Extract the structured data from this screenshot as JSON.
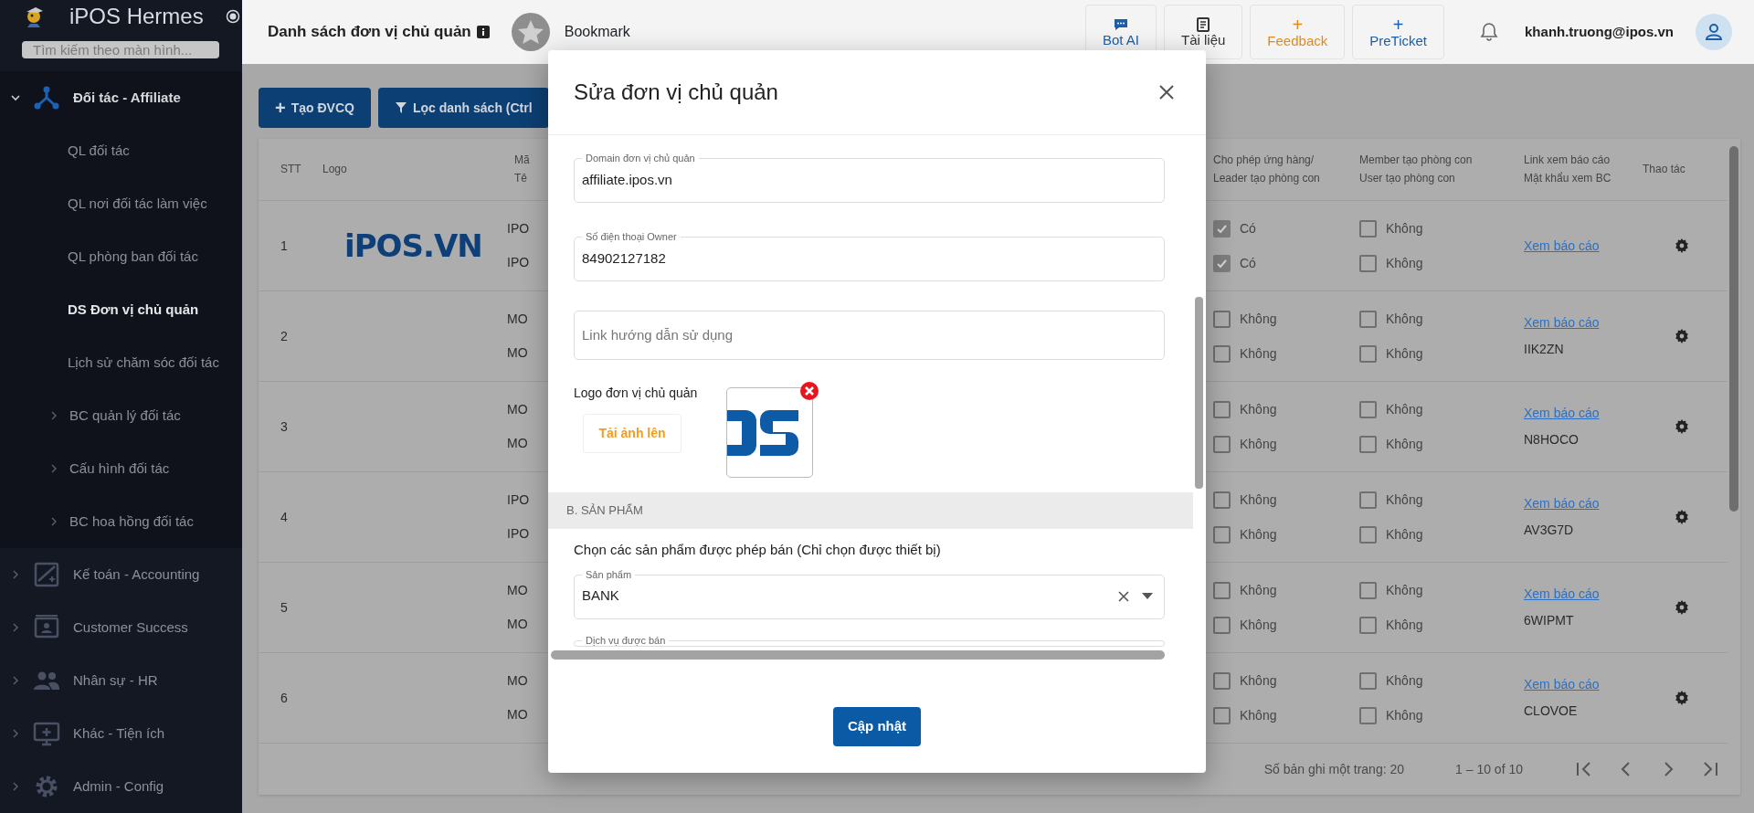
{
  "sidebar": {
    "app_name": "iPOS Hermes",
    "search": {
      "placeholder": "Tìm kiếm theo màn hình..."
    },
    "items": [
      {
        "label": "Đối tác - Affiliate",
        "expanded": true,
        "children": [
          {
            "label": "QL đối tác",
            "kind": "link",
            "selected": false
          },
          {
            "label": "QL nơi đối tác làm việc",
            "kind": "link",
            "selected": false
          },
          {
            "label": "QL phòng ban đối tác",
            "kind": "link",
            "selected": false
          },
          {
            "label": "DS Đơn vị chủ quản",
            "kind": "link",
            "selected": true
          },
          {
            "label": "Lịch sử chăm sóc đối tác",
            "kind": "link",
            "selected": false
          },
          {
            "label": "BC quản lý đối tác",
            "kind": "group",
            "selected": false
          },
          {
            "label": "Cấu hình đối tác",
            "kind": "group",
            "selected": false
          },
          {
            "label": "BC hoa hồng đối tác",
            "kind": "group",
            "selected": false
          }
        ]
      },
      {
        "label": "Kế toán - Accounting",
        "expanded": false
      },
      {
        "label": "Customer Success",
        "expanded": false
      },
      {
        "label": "Nhân sự - HR",
        "expanded": false
      },
      {
        "label": "Khác - Tiện ích",
        "expanded": false
      },
      {
        "label": "Admin - Config",
        "expanded": false
      }
    ]
  },
  "header": {
    "title": "Danh sách đơn vị chủ quản",
    "bookmark": "Bookmark",
    "actions": [
      {
        "label": "Bot AI",
        "kind": "chat",
        "color": "#1a5fa8"
      },
      {
        "label": "Tài liệu",
        "kind": "book",
        "color": "#333333"
      },
      {
        "label": "Feedback",
        "kind": "plus",
        "symbol": "+",
        "color": "#e08a1e"
      },
      {
        "label": "PreTicket",
        "kind": "plus",
        "symbol": "+",
        "color": "#1a5fa8"
      }
    ],
    "user": "khanh.truong@ipos.vn"
  },
  "toolbar": {
    "buttons": [
      {
        "label": "Tạo ĐVCQ",
        "symbol": "+",
        "kind": "add"
      },
      {
        "label": "Lọc danh sách (Ctrl",
        "kind": "filter"
      }
    ]
  },
  "table": {
    "columns": [
      {
        "lines": [
          "STT"
        ]
      },
      {
        "lines": [
          "Logo"
        ]
      },
      {
        "lines": [
          "Mã",
          "Tê"
        ]
      },
      {
        "lines": [
          "Cho phép ứng hàng/",
          "Leader tạo phòng con"
        ]
      },
      {
        "lines": [
          "Member tạo phòng con",
          "User tạo phòng con"
        ]
      },
      {
        "lines": [
          "Link xem báo cáo",
          "Mật khẩu xem BC"
        ]
      },
      {
        "lines": [
          "Thao tác"
        ]
      }
    ],
    "rows": [
      {
        "stt": "1",
        "logo_text": "iPOS.VN",
        "code": [
          "IPO",
          "IPO"
        ],
        "allow": [
          {
            "checked": true,
            "label": "Có"
          },
          {
            "checked": true,
            "label": "Có"
          }
        ],
        "member": [
          {
            "checked": false,
            "label": "Không"
          },
          {
            "checked": false,
            "label": "Không"
          }
        ],
        "link": "Xem báo cáo"
      },
      {
        "stt": "2",
        "code": [
          "MO",
          "MO"
        ],
        "allow": [
          {
            "checked": false,
            "label": "Không"
          },
          {
            "checked": false,
            "label": "Không"
          }
        ],
        "member": [
          {
            "checked": false,
            "label": "Không"
          },
          {
            "checked": false,
            "label": "Không"
          }
        ],
        "link": "Xem báo cáo",
        "password": "IIK2ZN"
      },
      {
        "stt": "3",
        "code": [
          "MO",
          "MO"
        ],
        "allow": [
          {
            "checked": false,
            "label": "Không"
          },
          {
            "checked": false,
            "label": "Không"
          }
        ],
        "member": [
          {
            "checked": false,
            "label": "Không"
          },
          {
            "checked": false,
            "label": "Không"
          }
        ],
        "link": "Xem báo cáo",
        "password": "N8HOCO"
      },
      {
        "stt": "4",
        "code": [
          "IPO",
          "IPO"
        ],
        "allow": [
          {
            "checked": false,
            "label": "Không"
          },
          {
            "checked": false,
            "label": "Không"
          }
        ],
        "member": [
          {
            "checked": false,
            "label": "Không"
          },
          {
            "checked": false,
            "label": "Không"
          }
        ],
        "link": "Xem báo cáo",
        "password": "AV3G7D"
      },
      {
        "stt": "5",
        "code": [
          "MO",
          "MO"
        ],
        "allow": [
          {
            "checked": false,
            "label": "Không"
          },
          {
            "checked": false,
            "label": "Không"
          }
        ],
        "member": [
          {
            "checked": false,
            "label": "Không"
          },
          {
            "checked": false,
            "label": "Không"
          }
        ],
        "link": "Xem báo cáo",
        "password": "6WIPMT"
      },
      {
        "stt": "6",
        "code": [
          "MO",
          "MO"
        ],
        "allow": [
          {
            "checked": false,
            "label": "Không"
          },
          {
            "checked": false,
            "label": "Không"
          }
        ],
        "member": [
          {
            "checked": false,
            "label": "Không"
          },
          {
            "checked": false,
            "label": "Không"
          }
        ],
        "link": "Xem báo cáo",
        "password": "CLOVOE"
      }
    ],
    "pagination": {
      "page_size": "Số bản ghi một trang: 20",
      "range": "1 – 10 of 10"
    }
  },
  "modal": {
    "title": "Sửa đơn vị chủ quản",
    "fields": [
      {
        "label": "Domain đơn vị chủ quản",
        "value": "affiliate.ipos.vn"
      },
      {
        "label": "Số điện thoại Owner",
        "value": "84902127182"
      },
      {
        "placeholder": "Link hướng dẫn sử dụng"
      }
    ],
    "logo": {
      "label": "Logo đơn vị chủ quản",
      "upload": "Tải ảnh lên"
    },
    "section": "B. SẢN PHẨM",
    "products_prompt": "Chọn các sản phẩm được phép bán (Chỉ chọn được thiết bị)",
    "product_select": {
      "label": "Sản phẩm",
      "value": "BANK"
    },
    "services_select": {
      "label": "Dịch vụ được bán"
    },
    "submit": "Cập nhật"
  }
}
